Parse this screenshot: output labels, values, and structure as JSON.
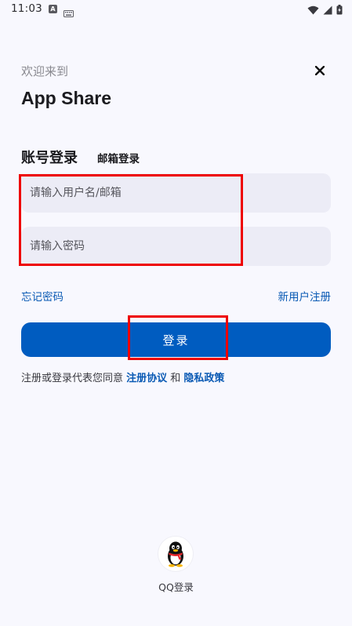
{
  "status_bar": {
    "time": "11:03",
    "notification_letter": "A"
  },
  "header": {
    "welcome": "欢迎来到",
    "app_name": "App Share"
  },
  "tabs": {
    "account": "账号登录",
    "email": "邮箱登录"
  },
  "form": {
    "username_placeholder": "请输入用户名/邮箱",
    "password_placeholder": "请输入密码",
    "username_value": "",
    "password_value": ""
  },
  "links": {
    "forgot_password": "忘记密码",
    "new_user_register": "新用户注册"
  },
  "login_button": {
    "label": "登录"
  },
  "agreement": {
    "prefix": "注册或登录代表您同意 ",
    "terms": "注册协议",
    "and": " 和 ",
    "privacy": "隐私政策"
  },
  "social": {
    "qq_label": "QQ登录"
  },
  "colors": {
    "background": "#f8f8fe",
    "primary": "#005cc0",
    "link": "#0a5ab4",
    "input_bg": "#ececf6",
    "highlight_frame": "#ee0000"
  }
}
